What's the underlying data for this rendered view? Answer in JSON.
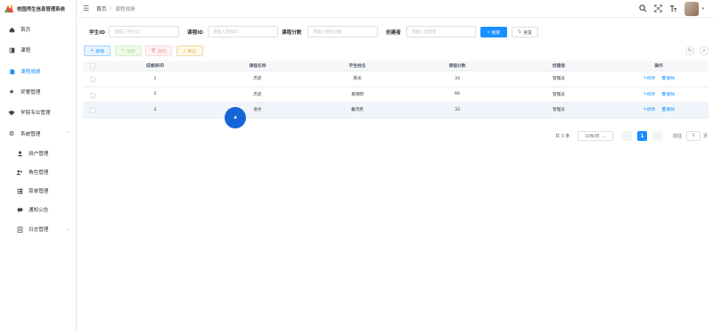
{
  "app": {
    "title": "校园师生信息管理系统"
  },
  "sidebar": {
    "items": [
      {
        "label": "首页",
        "icon": "home-icon"
      },
      {
        "label": "课程",
        "icon": "book-icon"
      },
      {
        "label": "课程成绩",
        "icon": "document-icon",
        "active": true
      },
      {
        "label": "奖奢管理",
        "icon": "star-icon"
      },
      {
        "label": "学院专业管理",
        "icon": "graduation-cap-icon"
      },
      {
        "label": "系统管理",
        "icon": "gear-icon",
        "expanded": true
      },
      {
        "label": "用户管理",
        "icon": "user-icon",
        "sub": true
      },
      {
        "label": "角色管理",
        "icon": "users-icon",
        "sub": true
      },
      {
        "label": "菜单管理",
        "icon": "list-icon",
        "sub": true
      },
      {
        "label": "通知公告",
        "icon": "message-icon",
        "sub": true
      },
      {
        "label": "日志管理",
        "icon": "log-icon",
        "sub": true
      }
    ]
  },
  "header": {
    "breadcrumb_home": "首页",
    "breadcrumb_current": "课程成绩",
    "breadcrumb_sep": "/"
  },
  "search": {
    "fields": [
      {
        "label": "学生ID",
        "placeholder": "请输入学生ID"
      },
      {
        "label": "课程ID",
        "placeholder": "请输入课程ID"
      },
      {
        "label": "课程分数",
        "placeholder": "请输入课程分数"
      },
      {
        "label": "创建者",
        "placeholder": "请输入创建者"
      }
    ],
    "search_label": "搜索",
    "reset_label": "重置"
  },
  "toolbar": {
    "add_label": "新增",
    "edit_label": "修改",
    "delete_label": "删除",
    "export_label": "导出"
  },
  "table": {
    "columns": [
      "成绩表ID",
      "课程名称",
      "学生姓名",
      "课程分数",
      "创建者",
      "操作"
    ],
    "rows": [
      {
        "id": "1",
        "course": "历史",
        "student": "蒋光",
        "score": "33",
        "creator": "管理员"
      },
      {
        "id": "2",
        "course": "历史",
        "student": "黄晓明",
        "score": "66",
        "creator": "管理员"
      },
      {
        "id": "3",
        "course": "语文",
        "student": "戴杰民",
        "score": "33",
        "creator": "管理员"
      }
    ],
    "op_edit": "修改",
    "op_delete": "删除"
  },
  "pagination": {
    "total_text": "共 3 条",
    "page_size": "10条/页",
    "current_page": "1",
    "goto_label": "前往",
    "goto_value": "1",
    "page_unit": "页"
  },
  "colors": {
    "accent": "#1890ff",
    "active_nav": "#1890ff",
    "click_indicator": "#1565d8"
  }
}
